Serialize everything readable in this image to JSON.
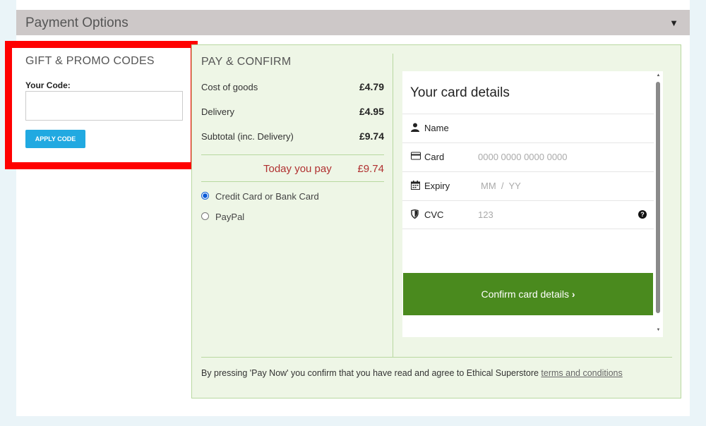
{
  "header": {
    "title": "Payment Options",
    "caret": "▼"
  },
  "promo": {
    "title": "GIFT & PROMO CODES",
    "code_label": "Your Code:",
    "code_value": "",
    "apply_label": "APPLY CODE"
  },
  "pay": {
    "title": "PAY & CONFIRM",
    "rows": [
      {
        "label": "Cost of goods",
        "value": "£4.79"
      },
      {
        "label": "Delivery",
        "value": "£4.95"
      },
      {
        "label": "Subtotal (inc. Delivery)",
        "value": "£9.74"
      }
    ],
    "today_label": "Today you pay",
    "today_value": "£9.74",
    "methods": [
      {
        "label": "Credit Card or Bank Card",
        "selected": true
      },
      {
        "label": "PayPal",
        "selected": false
      }
    ]
  },
  "card": {
    "title": "Your card details",
    "fields": [
      {
        "label": "Name",
        "placeholder": "",
        "icon": "user-icon"
      },
      {
        "label": "Card",
        "placeholder": "0000 0000 0000 0000",
        "icon": "credit-card-icon"
      },
      {
        "label": "Expiry",
        "placeholder": "MM  /  YY",
        "icon": "calendar-icon"
      },
      {
        "label": "CVC",
        "placeholder": "123",
        "icon": "shield-icon"
      }
    ],
    "confirm_label": "Confirm card details"
  },
  "terms": {
    "text": "By pressing 'Pay Now' you confirm that you have read and agree to Ethical Superstore ",
    "link": "terms and conditions"
  },
  "colors": {
    "accent_blue": "#21a9e1",
    "confirm_green": "#4a8a1e",
    "highlight_red": "#ff0000",
    "total_red": "#b03030",
    "panel_green": "#eef6e6"
  }
}
